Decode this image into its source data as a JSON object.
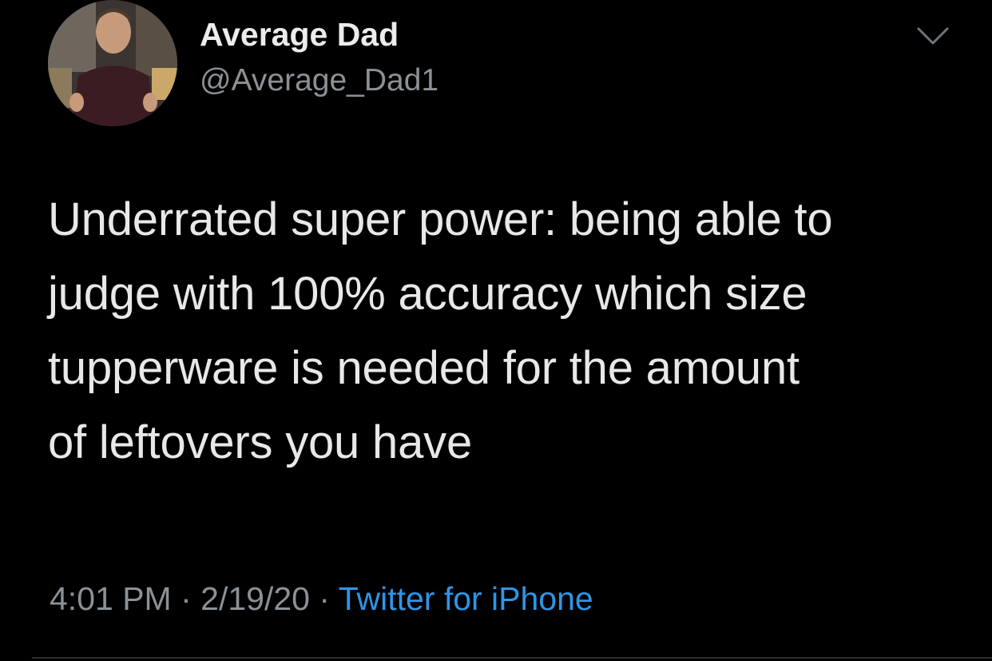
{
  "tweet": {
    "author": {
      "display_name": "Average Dad",
      "handle": "@Average_Dad1",
      "avatar_icon": "profile-photo"
    },
    "menu_icon": "chevron-down-icon",
    "text_lines": [
      "Underrated super power: being able to",
      "judge with 100% accuracy which size",
      "tupperware is needed for the amount",
      "of leftovers you have"
    ],
    "meta": {
      "time": "4:01 PM",
      "separator": "·",
      "date": "2/19/20",
      "source": "Twitter for iPhone"
    }
  },
  "colors": {
    "background": "#000000",
    "text": "#e8e8e8",
    "secondary": "#8b9197",
    "link": "#2f95e6"
  }
}
